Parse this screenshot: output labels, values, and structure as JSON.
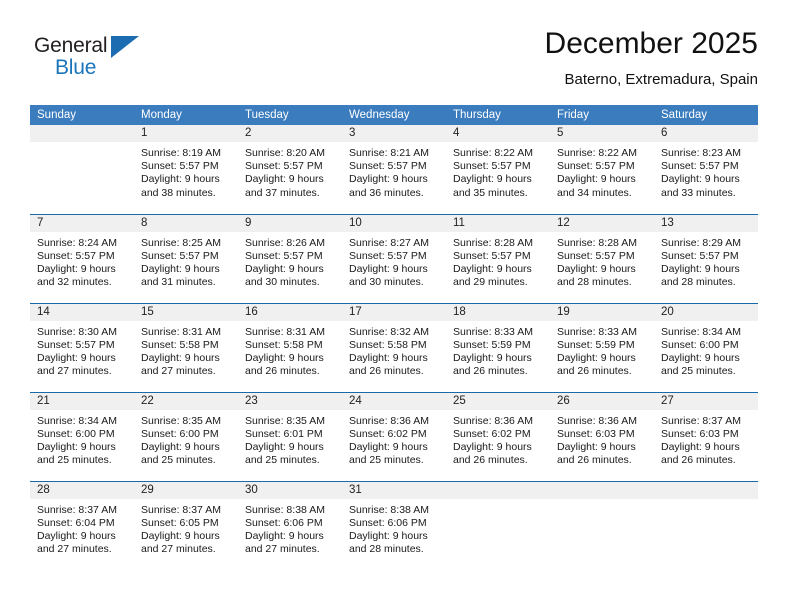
{
  "brand": {
    "name_top": "General",
    "name_bottom": "Blue",
    "top_color": "#231f20",
    "bottom_color": "#1b75bb",
    "triangle_color": "#1b6cb0",
    "triangle_icon": "triangle-icon"
  },
  "header": {
    "title": "December 2025",
    "subtitle": "Baterno, Extremadura, Spain"
  },
  "theme": {
    "header_bg": "#3a7cbe",
    "header_text": "#ffffff",
    "daynum_band_bg": "#f0f0f0",
    "week_divider": "#1a6aaa",
    "cell_bg": "#ffffff",
    "text": "#1a1a1a"
  },
  "calendar": {
    "weekday_headers": [
      "Sunday",
      "Monday",
      "Tuesday",
      "Wednesday",
      "Thursday",
      "Friday",
      "Saturday"
    ],
    "weeks": [
      [
        {
          "day": "",
          "empty": true,
          "sunrise": "",
          "sunset": "",
          "daylight_line1": "",
          "daylight_line2": ""
        },
        {
          "day": "1",
          "sunrise": "Sunrise: 8:19 AM",
          "sunset": "Sunset: 5:57 PM",
          "daylight_line1": "Daylight: 9 hours",
          "daylight_line2": "and 38 minutes."
        },
        {
          "day": "2",
          "sunrise": "Sunrise: 8:20 AM",
          "sunset": "Sunset: 5:57 PM",
          "daylight_line1": "Daylight: 9 hours",
          "daylight_line2": "and 37 minutes."
        },
        {
          "day": "3",
          "sunrise": "Sunrise: 8:21 AM",
          "sunset": "Sunset: 5:57 PM",
          "daylight_line1": "Daylight: 9 hours",
          "daylight_line2": "and 36 minutes."
        },
        {
          "day": "4",
          "sunrise": "Sunrise: 8:22 AM",
          "sunset": "Sunset: 5:57 PM",
          "daylight_line1": "Daylight: 9 hours",
          "daylight_line2": "and 35 minutes."
        },
        {
          "day": "5",
          "sunrise": "Sunrise: 8:22 AM",
          "sunset": "Sunset: 5:57 PM",
          "daylight_line1": "Daylight: 9 hours",
          "daylight_line2": "and 34 minutes."
        },
        {
          "day": "6",
          "sunrise": "Sunrise: 8:23 AM",
          "sunset": "Sunset: 5:57 PM",
          "daylight_line1": "Daylight: 9 hours",
          "daylight_line2": "and 33 minutes."
        }
      ],
      [
        {
          "day": "7",
          "sunrise": "Sunrise: 8:24 AM",
          "sunset": "Sunset: 5:57 PM",
          "daylight_line1": "Daylight: 9 hours",
          "daylight_line2": "and 32 minutes."
        },
        {
          "day": "8",
          "sunrise": "Sunrise: 8:25 AM",
          "sunset": "Sunset: 5:57 PM",
          "daylight_line1": "Daylight: 9 hours",
          "daylight_line2": "and 31 minutes."
        },
        {
          "day": "9",
          "sunrise": "Sunrise: 8:26 AM",
          "sunset": "Sunset: 5:57 PM",
          "daylight_line1": "Daylight: 9 hours",
          "daylight_line2": "and 30 minutes."
        },
        {
          "day": "10",
          "sunrise": "Sunrise: 8:27 AM",
          "sunset": "Sunset: 5:57 PM",
          "daylight_line1": "Daylight: 9 hours",
          "daylight_line2": "and 30 minutes."
        },
        {
          "day": "11",
          "sunrise": "Sunrise: 8:28 AM",
          "sunset": "Sunset: 5:57 PM",
          "daylight_line1": "Daylight: 9 hours",
          "daylight_line2": "and 29 minutes."
        },
        {
          "day": "12",
          "sunrise": "Sunrise: 8:28 AM",
          "sunset": "Sunset: 5:57 PM",
          "daylight_line1": "Daylight: 9 hours",
          "daylight_line2": "and 28 minutes."
        },
        {
          "day": "13",
          "sunrise": "Sunrise: 8:29 AM",
          "sunset": "Sunset: 5:57 PM",
          "daylight_line1": "Daylight: 9 hours",
          "daylight_line2": "and 28 minutes."
        }
      ],
      [
        {
          "day": "14",
          "sunrise": "Sunrise: 8:30 AM",
          "sunset": "Sunset: 5:57 PM",
          "daylight_line1": "Daylight: 9 hours",
          "daylight_line2": "and 27 minutes."
        },
        {
          "day": "15",
          "sunrise": "Sunrise: 8:31 AM",
          "sunset": "Sunset: 5:58 PM",
          "daylight_line1": "Daylight: 9 hours",
          "daylight_line2": "and 27 minutes."
        },
        {
          "day": "16",
          "sunrise": "Sunrise: 8:31 AM",
          "sunset": "Sunset: 5:58 PM",
          "daylight_line1": "Daylight: 9 hours",
          "daylight_line2": "and 26 minutes."
        },
        {
          "day": "17",
          "sunrise": "Sunrise: 8:32 AM",
          "sunset": "Sunset: 5:58 PM",
          "daylight_line1": "Daylight: 9 hours",
          "daylight_line2": "and 26 minutes."
        },
        {
          "day": "18",
          "sunrise": "Sunrise: 8:33 AM",
          "sunset": "Sunset: 5:59 PM",
          "daylight_line1": "Daylight: 9 hours",
          "daylight_line2": "and 26 minutes."
        },
        {
          "day": "19",
          "sunrise": "Sunrise: 8:33 AM",
          "sunset": "Sunset: 5:59 PM",
          "daylight_line1": "Daylight: 9 hours",
          "daylight_line2": "and 26 minutes."
        },
        {
          "day": "20",
          "sunrise": "Sunrise: 8:34 AM",
          "sunset": "Sunset: 6:00 PM",
          "daylight_line1": "Daylight: 9 hours",
          "daylight_line2": "and 25 minutes."
        }
      ],
      [
        {
          "day": "21",
          "sunrise": "Sunrise: 8:34 AM",
          "sunset": "Sunset: 6:00 PM",
          "daylight_line1": "Daylight: 9 hours",
          "daylight_line2": "and 25 minutes."
        },
        {
          "day": "22",
          "sunrise": "Sunrise: 8:35 AM",
          "sunset": "Sunset: 6:00 PM",
          "daylight_line1": "Daylight: 9 hours",
          "daylight_line2": "and 25 minutes."
        },
        {
          "day": "23",
          "sunrise": "Sunrise: 8:35 AM",
          "sunset": "Sunset: 6:01 PM",
          "daylight_line1": "Daylight: 9 hours",
          "daylight_line2": "and 25 minutes."
        },
        {
          "day": "24",
          "sunrise": "Sunrise: 8:36 AM",
          "sunset": "Sunset: 6:02 PM",
          "daylight_line1": "Daylight: 9 hours",
          "daylight_line2": "and 25 minutes."
        },
        {
          "day": "25",
          "sunrise": "Sunrise: 8:36 AM",
          "sunset": "Sunset: 6:02 PM",
          "daylight_line1": "Daylight: 9 hours",
          "daylight_line2": "and 26 minutes."
        },
        {
          "day": "26",
          "sunrise": "Sunrise: 8:36 AM",
          "sunset": "Sunset: 6:03 PM",
          "daylight_line1": "Daylight: 9 hours",
          "daylight_line2": "and 26 minutes."
        },
        {
          "day": "27",
          "sunrise": "Sunrise: 8:37 AM",
          "sunset": "Sunset: 6:03 PM",
          "daylight_line1": "Daylight: 9 hours",
          "daylight_line2": "and 26 minutes."
        }
      ],
      [
        {
          "day": "28",
          "sunrise": "Sunrise: 8:37 AM",
          "sunset": "Sunset: 6:04 PM",
          "daylight_line1": "Daylight: 9 hours",
          "daylight_line2": "and 27 minutes."
        },
        {
          "day": "29",
          "sunrise": "Sunrise: 8:37 AM",
          "sunset": "Sunset: 6:05 PM",
          "daylight_line1": "Daylight: 9 hours",
          "daylight_line2": "and 27 minutes."
        },
        {
          "day": "30",
          "sunrise": "Sunrise: 8:38 AM",
          "sunset": "Sunset: 6:06 PM",
          "daylight_line1": "Daylight: 9 hours",
          "daylight_line2": "and 27 minutes."
        },
        {
          "day": "31",
          "sunrise": "Sunrise: 8:38 AM",
          "sunset": "Sunset: 6:06 PM",
          "daylight_line1": "Daylight: 9 hours",
          "daylight_line2": "and 28 minutes."
        },
        {
          "day": "",
          "empty": true,
          "sunrise": "",
          "sunset": "",
          "daylight_line1": "",
          "daylight_line2": ""
        },
        {
          "day": "",
          "empty": true,
          "sunrise": "",
          "sunset": "",
          "daylight_line1": "",
          "daylight_line2": ""
        },
        {
          "day": "",
          "empty": true,
          "sunrise": "",
          "sunset": "",
          "daylight_line1": "",
          "daylight_line2": ""
        }
      ]
    ]
  }
}
